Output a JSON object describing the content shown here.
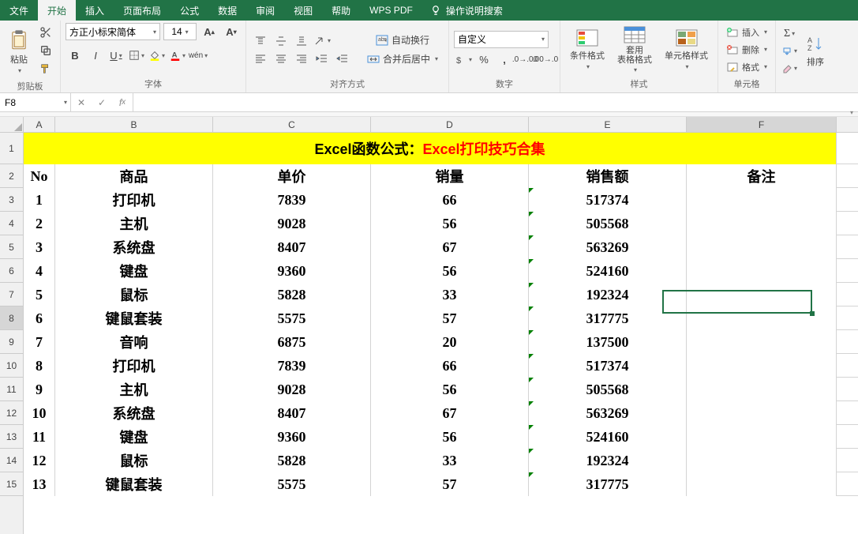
{
  "menu": {
    "tabs": [
      "文件",
      "开始",
      "插入",
      "页面布局",
      "公式",
      "数据",
      "审阅",
      "视图",
      "帮助",
      "WPS PDF"
    ],
    "active": 1,
    "search_label": "操作说明搜索"
  },
  "ribbon": {
    "clipboard": {
      "paste": "粘贴",
      "label": "剪贴板"
    },
    "font": {
      "name": "方正小标宋简体",
      "size": "14",
      "label": "字体"
    },
    "align": {
      "wrap": "自动换行",
      "merge": "合并后居中",
      "label": "对齐方式"
    },
    "number": {
      "format": "自定义",
      "label": "数字"
    },
    "styles": {
      "cond": "条件格式",
      "table": "套用\n表格格式",
      "cell": "单元格样式",
      "label": "样式"
    },
    "cells": {
      "insert": "插入",
      "delete": "删除",
      "format": "格式",
      "label": "单元格"
    },
    "editing": {
      "sort": "排序"
    }
  },
  "namebox": "F8",
  "grid": {
    "cols": [
      "A",
      "B",
      "C",
      "D",
      "E",
      "F"
    ],
    "title_black": "Excel函数公式：",
    "title_red": "Excel打印技巧合集",
    "headers": [
      "No",
      "商品",
      "单价",
      "销量",
      "销售额",
      "备注"
    ],
    "rows": [
      {
        "no": "1",
        "p": "打印机",
        "u": "7839",
        "q": "66",
        "s": "517374",
        "r": ""
      },
      {
        "no": "2",
        "p": "主机",
        "u": "9028",
        "q": "56",
        "s": "505568",
        "r": ""
      },
      {
        "no": "3",
        "p": "系统盘",
        "u": "8407",
        "q": "67",
        "s": "563269",
        "r": ""
      },
      {
        "no": "4",
        "p": "键盘",
        "u": "9360",
        "q": "56",
        "s": "524160",
        "r": ""
      },
      {
        "no": "5",
        "p": "鼠标",
        "u": "5828",
        "q": "33",
        "s": "192324",
        "r": ""
      },
      {
        "no": "6",
        "p": "键鼠套装",
        "u": "5575",
        "q": "57",
        "s": "317775",
        "r": ""
      },
      {
        "no": "7",
        "p": "音响",
        "u": "6875",
        "q": "20",
        "s": "137500",
        "r": ""
      },
      {
        "no": "8",
        "p": "打印机",
        "u": "7839",
        "q": "66",
        "s": "517374",
        "r": ""
      },
      {
        "no": "9",
        "p": "主机",
        "u": "9028",
        "q": "56",
        "s": "505568",
        "r": ""
      },
      {
        "no": "10",
        "p": "系统盘",
        "u": "8407",
        "q": "67",
        "s": "563269",
        "r": ""
      },
      {
        "no": "11",
        "p": "键盘",
        "u": "9360",
        "q": "56",
        "s": "524160",
        "r": ""
      },
      {
        "no": "12",
        "p": "鼠标",
        "u": "5828",
        "q": "33",
        "s": "192324",
        "r": ""
      },
      {
        "no": "13",
        "p": "键鼠套装",
        "u": "5575",
        "q": "57",
        "s": "317775",
        "r": ""
      }
    ],
    "active_cell": "F8",
    "row_heights": {
      "title": 40,
      "header": 30,
      "data": 30
    }
  }
}
